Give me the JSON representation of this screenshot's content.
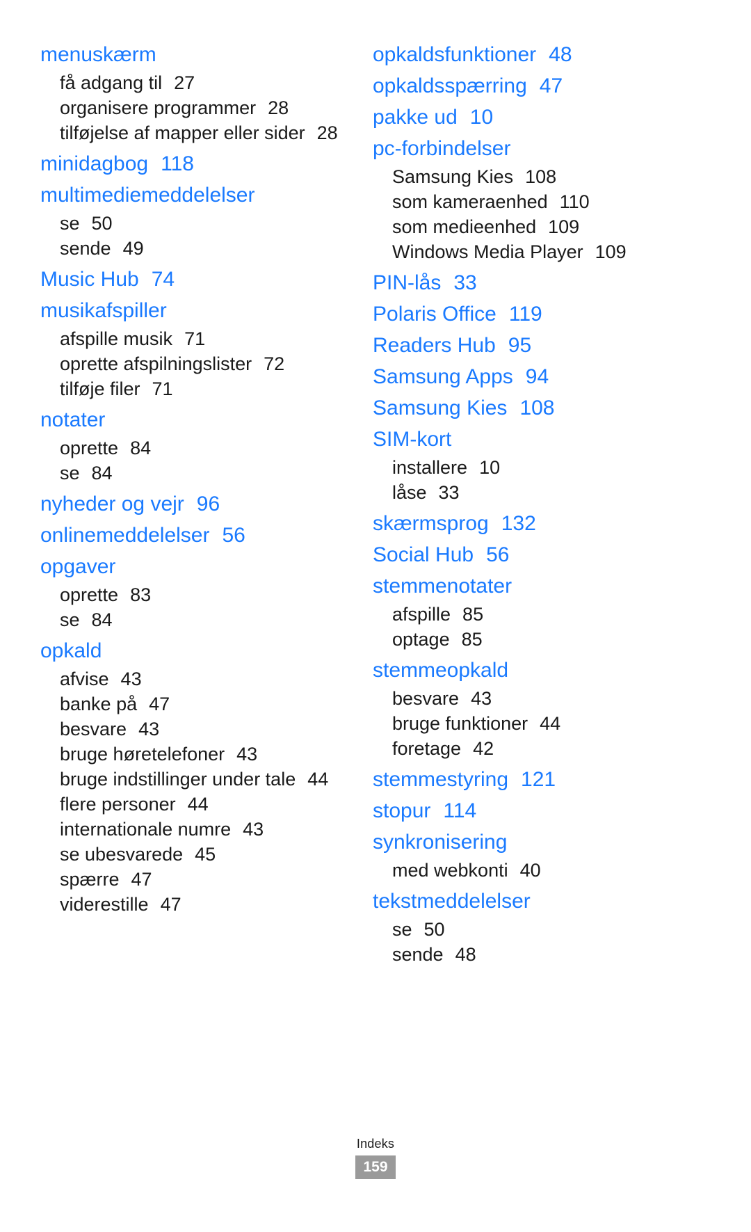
{
  "document": {
    "type": "index-page",
    "footer_label": "Indeks",
    "page_number": "159",
    "accent_color": "#1a7aff",
    "text_color": "#1a1a1a",
    "page_badge_color": "#9a9a9a"
  },
  "columns": [
    {
      "name": "left-column",
      "entries": [
        {
          "term": "menuskærm",
          "page": "",
          "subs": [
            {
              "label": "få adgang til",
              "page": "27"
            },
            {
              "label": "organisere programmer",
              "page": "28"
            },
            {
              "label": "tilføjelse af mapper eller sider",
              "page": "28"
            }
          ]
        },
        {
          "term": "minidagbog",
          "page": "118",
          "subs": []
        },
        {
          "term": "multimediemeddelelser",
          "page": "",
          "subs": [
            {
              "label": "se",
              "page": "50"
            },
            {
              "label": "sende",
              "page": "49"
            }
          ]
        },
        {
          "term": "Music Hub",
          "page": "74",
          "subs": []
        },
        {
          "term": "musikafspiller",
          "page": "",
          "subs": [
            {
              "label": "afspille musik",
              "page": "71"
            },
            {
              "label": "oprette afspilningslister",
              "page": "72"
            },
            {
              "label": "tilføje filer",
              "page": "71"
            }
          ]
        },
        {
          "term": "notater",
          "page": "",
          "subs": [
            {
              "label": "oprette",
              "page": "84"
            },
            {
              "label": "se",
              "page": "84"
            }
          ]
        },
        {
          "term": "nyheder og vejr",
          "page": "96",
          "subs": []
        },
        {
          "term": "onlinemeddelelser",
          "page": "56",
          "subs": []
        },
        {
          "term": "opgaver",
          "page": "",
          "subs": [
            {
              "label": "oprette",
              "page": "83"
            },
            {
              "label": "se",
              "page": "84"
            }
          ]
        },
        {
          "term": "opkald",
          "page": "",
          "subs": [
            {
              "label": "afvise",
              "page": "43"
            },
            {
              "label": "banke på",
              "page": "47"
            },
            {
              "label": "besvare",
              "page": "43"
            },
            {
              "label": "bruge høretelefoner",
              "page": "43"
            },
            {
              "label": "bruge indstillinger under tale",
              "page": "44"
            },
            {
              "label": "flere personer",
              "page": "44"
            },
            {
              "label": "internationale numre",
              "page": "43"
            },
            {
              "label": "se ubesvarede",
              "page": "45"
            },
            {
              "label": "spærre",
              "page": "47"
            },
            {
              "label": "viderestille",
              "page": "47"
            }
          ]
        }
      ]
    },
    {
      "name": "right-column",
      "entries": [
        {
          "term": "opkaldsfunktioner",
          "page": "48",
          "subs": []
        },
        {
          "term": "opkaldsspærring",
          "page": "47",
          "subs": []
        },
        {
          "term": "pakke ud",
          "page": "10",
          "subs": []
        },
        {
          "term": "pc-forbindelser",
          "page": "",
          "subs": [
            {
              "label": "Samsung Kies",
              "page": "108"
            },
            {
              "label": "som kameraenhed",
              "page": "110"
            },
            {
              "label": "som medieenhed",
              "page": "109"
            },
            {
              "label": "Windows Media Player",
              "page": "109"
            }
          ]
        },
        {
          "term": "PIN-lås",
          "page": "33",
          "subs": []
        },
        {
          "term": "Polaris Office",
          "page": "119",
          "subs": []
        },
        {
          "term": "Readers Hub",
          "page": "95",
          "subs": []
        },
        {
          "term": "Samsung Apps",
          "page": "94",
          "subs": []
        },
        {
          "term": "Samsung Kies",
          "page": "108",
          "subs": []
        },
        {
          "term": "SIM-kort",
          "page": "",
          "subs": [
            {
              "label": "installere",
              "page": "10"
            },
            {
              "label": "låse",
              "page": "33"
            }
          ]
        },
        {
          "term": "skærmsprog",
          "page": "132",
          "subs": []
        },
        {
          "term": "Social Hub",
          "page": "56",
          "subs": []
        },
        {
          "term": "stemmenotater",
          "page": "",
          "subs": [
            {
              "label": "afspille",
              "page": "85"
            },
            {
              "label": "optage",
              "page": "85"
            }
          ]
        },
        {
          "term": "stemmeopkald",
          "page": "",
          "subs": [
            {
              "label": "besvare",
              "page": "43"
            },
            {
              "label": "bruge funktioner",
              "page": "44"
            },
            {
              "label": "foretage",
              "page": "42"
            }
          ]
        },
        {
          "term": "stemmestyring",
          "page": "121",
          "subs": []
        },
        {
          "term": "stopur",
          "page": "114",
          "subs": []
        },
        {
          "term": "synkronisering",
          "page": "",
          "subs": [
            {
              "label": "med webkonti",
              "page": "40"
            }
          ]
        },
        {
          "term": "tekstmeddelelser",
          "page": "",
          "subs": [
            {
              "label": "se",
              "page": "50"
            },
            {
              "label": "sende",
              "page": "48"
            }
          ]
        }
      ]
    }
  ]
}
